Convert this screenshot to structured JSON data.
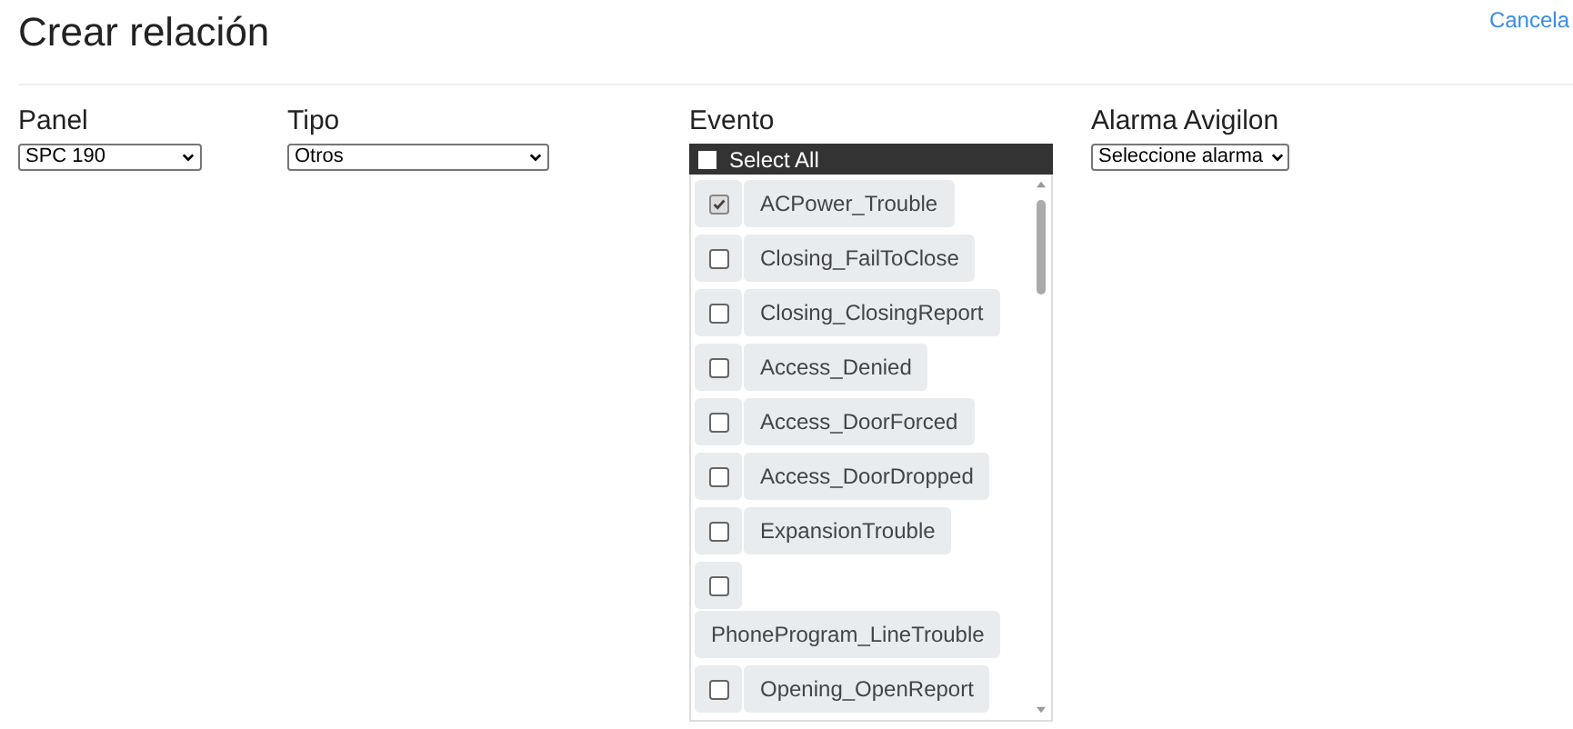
{
  "title": "Crear relación",
  "cancel_link": "Cancela",
  "panel": {
    "label": "Panel",
    "value": "SPC 190"
  },
  "tipo": {
    "label": "Tipo",
    "value": "Otros"
  },
  "evento": {
    "label": "Evento",
    "select_all": {
      "label": "Select All",
      "checked": false
    },
    "items": [
      {
        "label": "ACPower_Trouble",
        "checked": true
      },
      {
        "label": "Closing_FailToClose",
        "checked": false
      },
      {
        "label": "Closing_ClosingReport",
        "checked": false
      },
      {
        "label": "Access_Denied",
        "checked": false
      },
      {
        "label": "Access_DoorForced",
        "checked": false
      },
      {
        "label": "Access_DoorDropped",
        "checked": false
      },
      {
        "label": "ExpansionTrouble",
        "checked": false
      },
      {
        "label": "PhoneProgram_LineTrouble",
        "checked": false
      },
      {
        "label": "Opening_OpenReport",
        "checked": false
      }
    ]
  },
  "alarma": {
    "label": "Alarma Avigilon",
    "value": "Seleccione alarma"
  }
}
